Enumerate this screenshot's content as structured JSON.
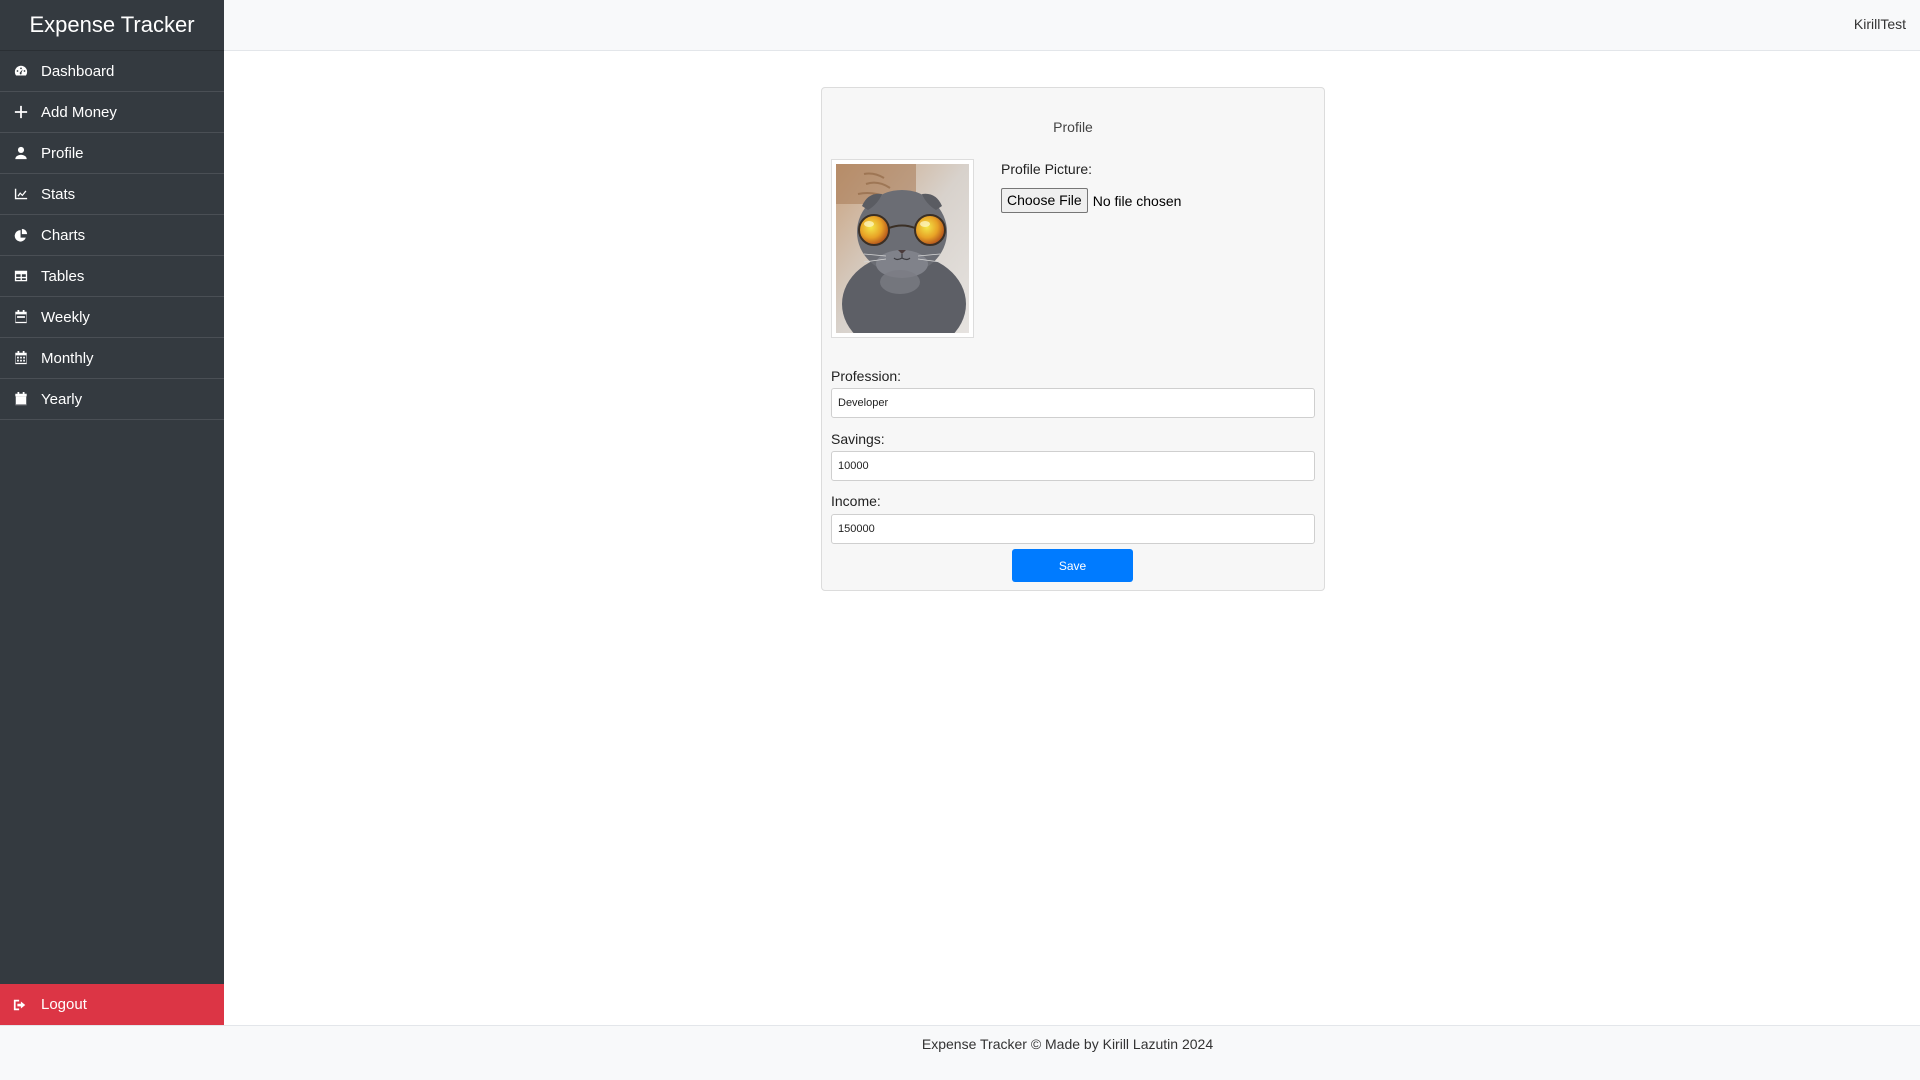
{
  "app": {
    "title": "Expense Tracker",
    "username": "KirillTest"
  },
  "sidebar": {
    "items": [
      {
        "label": "Dashboard",
        "icon": "gauge-icon"
      },
      {
        "label": "Add Money",
        "icon": "plus-icon"
      },
      {
        "label": "Profile",
        "icon": "user-icon"
      },
      {
        "label": "Stats",
        "icon": "line-chart-icon"
      },
      {
        "label": "Charts",
        "icon": "pie-chart-icon"
      },
      {
        "label": "Tables",
        "icon": "table-icon"
      },
      {
        "label": "Weekly",
        "icon": "calendar-week-icon"
      },
      {
        "label": "Monthly",
        "icon": "calendar-days-icon"
      },
      {
        "label": "Yearly",
        "icon": "calendar-icon"
      }
    ],
    "logout": {
      "label": "Logout",
      "icon": "sign-out-icon"
    }
  },
  "profile": {
    "title": "Profile",
    "picture_label": "Profile Picture:",
    "choose_file": "Choose File",
    "no_file": "No file chosen",
    "profession_label": "Profession:",
    "profession_value": "Developer",
    "savings_label": "Savings:",
    "savings_value": "10000",
    "income_label": "Income:",
    "income_value": "150000",
    "save_label": "Save"
  },
  "footer": {
    "text": "Expense Tracker © Made by Kirill Lazutin 2024"
  },
  "colors": {
    "sidebar_bg": "#343a40",
    "logout_bg": "#dc3545",
    "primary": "#007bff"
  }
}
